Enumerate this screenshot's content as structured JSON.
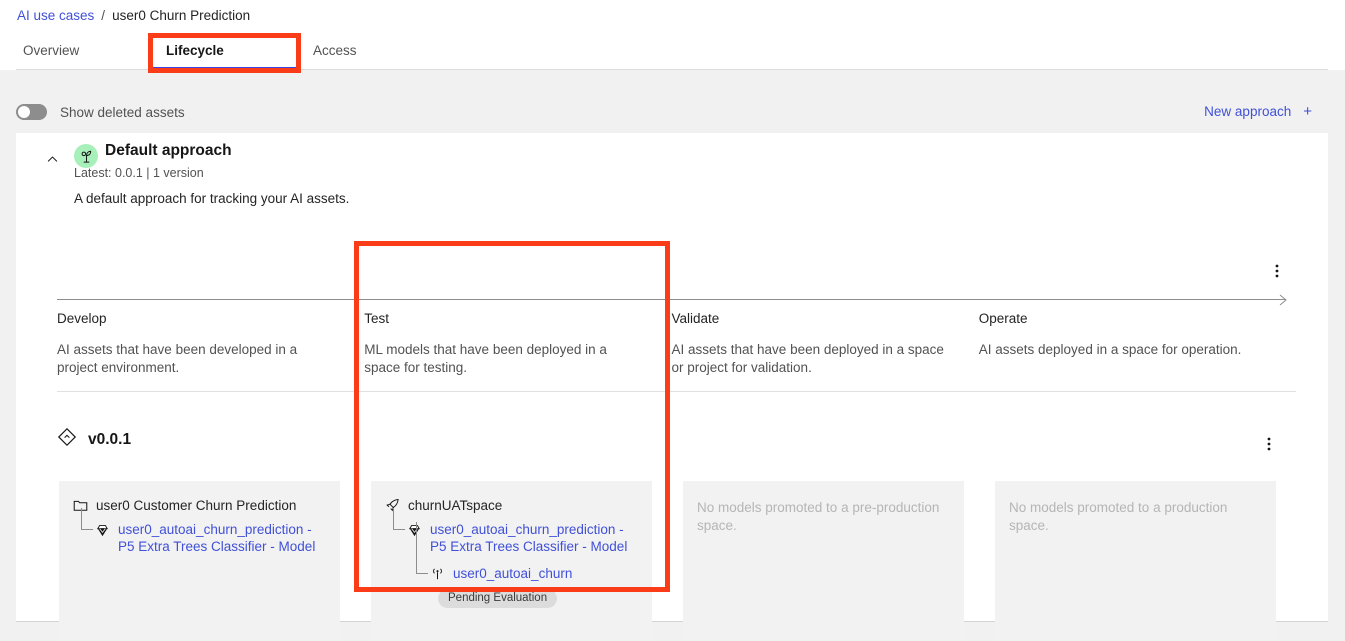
{
  "breadcrumb": {
    "root": "AI use cases",
    "separator": "/",
    "current": "user0 Churn Prediction"
  },
  "tabs": [
    {
      "label": "Overview",
      "active": false
    },
    {
      "label": "Lifecycle",
      "active": true
    },
    {
      "label": "Access",
      "active": false
    }
  ],
  "toolbar": {
    "toggle_label": "Show deleted assets",
    "toggle_state": "off",
    "new_approach_label": "New approach",
    "new_approach_icon": "plus-icon"
  },
  "approach": {
    "icon": "sprout-icon",
    "title": "Default approach",
    "subtitle": "Latest: 0.0.1 | 1 version",
    "description": "A default approach for tracking your AI assets.",
    "collapse_icon": "chevron-up-icon",
    "overflow_icon": "overflow-menu-vertical-icon"
  },
  "stages": [
    {
      "title": "Develop",
      "description": "AI assets that have been developed in a project environment."
    },
    {
      "title": "Test",
      "description": "ML models that have been deployed in a space for testing."
    },
    {
      "title": "Validate",
      "description": "AI assets that have been deployed in a space or project for validation."
    },
    {
      "title": "Operate",
      "description": "AI assets deployed in a space for operation."
    }
  ],
  "version": {
    "icon": "version-diamond-icon",
    "label": "v0.0.1",
    "overflow_icon": "overflow-menu-vertical-icon"
  },
  "cards": [
    {
      "stage": "Develop",
      "empty": false,
      "root": {
        "icon": "folder-icon",
        "label": "user0 Customer Churn Prediction"
      },
      "children": [
        {
          "level": 1,
          "icon": "model-gem-icon",
          "label": "user0_autoai_churn_prediction - P5 Extra Trees Classifier - Model",
          "badge": null
        }
      ]
    },
    {
      "stage": "Test",
      "empty": false,
      "root": {
        "icon": "rocket-icon",
        "label": "churnUATspace"
      },
      "children": [
        {
          "level": 1,
          "icon": "model-gem-icon",
          "label": "user0_autoai_churn_prediction - P5 Extra Trees Classifier - Model",
          "badge": null
        },
        {
          "level": 2,
          "icon": "deployment-signal-icon",
          "label": "user0_autoai_churn",
          "badge": "Pending Evaluation"
        }
      ]
    },
    {
      "stage": "Validate",
      "empty": true,
      "empty_text": "No models promoted to a pre-production space."
    },
    {
      "stage": "Operate",
      "empty": true,
      "empty_text": "No models promoted to a production space."
    }
  ],
  "annotations": [
    {
      "name": "lifecycle-tab-highlight",
      "color": "#fa3c18"
    },
    {
      "name": "test-column-highlight",
      "color": "#fa3c18"
    }
  ],
  "colors": {
    "link": "#4050d8",
    "accent": "#3b44e0",
    "annotation": "#fa3c18",
    "sprout_bg": "#a7f0ba",
    "page_bg": "#f1f1f1",
    "card_bg": "#f2f2f2"
  }
}
